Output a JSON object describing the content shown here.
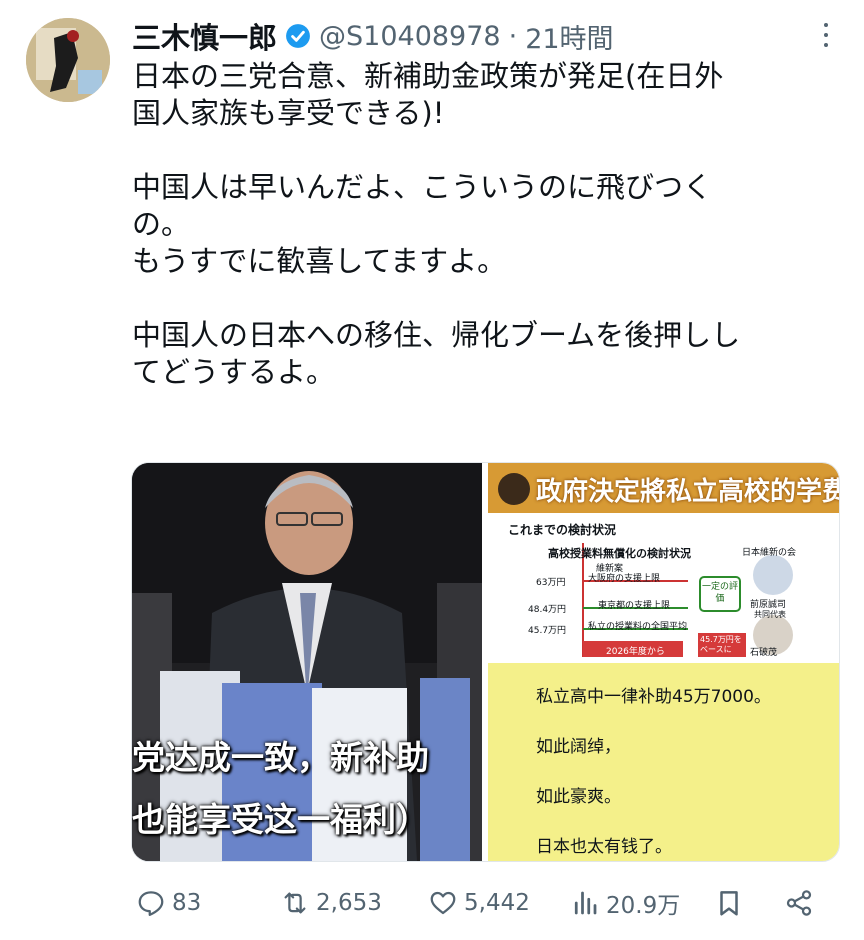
{
  "tweet": {
    "author_name": "三木慎一郎",
    "handle": "@S10408978",
    "separator": "·",
    "time": "21時間",
    "text_lines": [
      "日本の三党合意、新補助金政策が発足(在日外",
      "国人家族も享受できる)!",
      "",
      "中国人は早いんだよ、こういうのに飛びつく",
      "の。",
      "もうすでに歓喜してますよ。",
      "",
      "中国人の日本への移住、帰化ブームを後押しし",
      "てどうするよ。"
    ]
  },
  "media": {
    "left_image": {
      "caption_line1": "党达成一致，新补助",
      "caption_line2": "也能享受这一福利）"
    },
    "right_top_image": {
      "banner": "政府決定將私立高校的学费无偿化补助",
      "heading": "これまでの検討状況",
      "subheading": "高校授業料無償化の検討状況",
      "party": "日本維新の会",
      "proposal": "維新案",
      "row1_value": "63万円",
      "row1_label": "大阪府の支援上限",
      "row2_value": "48.4万円",
      "row2_label": "東京都の支援上限",
      "row3_value": "45.7万円",
      "row3_label": "私立の授業料の全国平均",
      "badge": "一定の評価",
      "person1": "前原誠司",
      "person1_title": "共同代表",
      "footer_left": "2026年度から",
      "footer_right": "45.7万円をベースに",
      "person2": "石破茂"
    },
    "right_bottom_image": {
      "lines": [
        "私立高中一律补助45万7000。",
        "如此阔绰，",
        "如此豪爽。",
        "日本也太有钱了。"
      ]
    }
  },
  "actions": {
    "replies": "83",
    "reposts": "2,653",
    "likes": "5,442",
    "views": "20.9万"
  },
  "colors": {
    "verified": "#1d9bf0",
    "secondary_text": "#536471",
    "yellow_panel": "#f4f08a"
  }
}
